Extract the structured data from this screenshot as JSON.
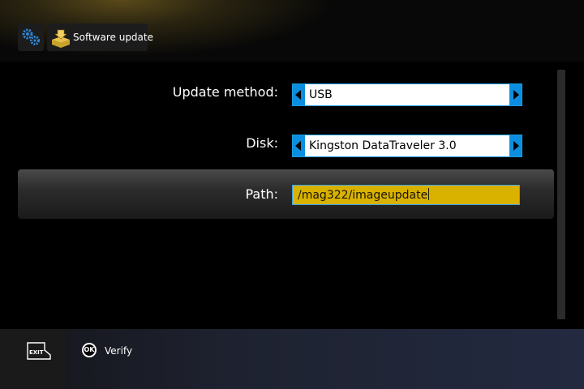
{
  "header": {
    "title": "Software update",
    "settings_icon": "gears-icon",
    "section_icon": "update-box-icon"
  },
  "form": {
    "update_method": {
      "label": "Update method:",
      "value": "USB"
    },
    "disk": {
      "label": "Disk:",
      "value": "Kingston DataTraveler 3.0"
    },
    "path": {
      "label": "Path:",
      "value": "/mag322/imageupdate"
    }
  },
  "footer": {
    "exit_label": "EXIT",
    "ok_label": "OK",
    "verify_label": "Verify"
  },
  "colors": {
    "accent": "#0c8ee0",
    "path_highlight": "#d9b200"
  }
}
